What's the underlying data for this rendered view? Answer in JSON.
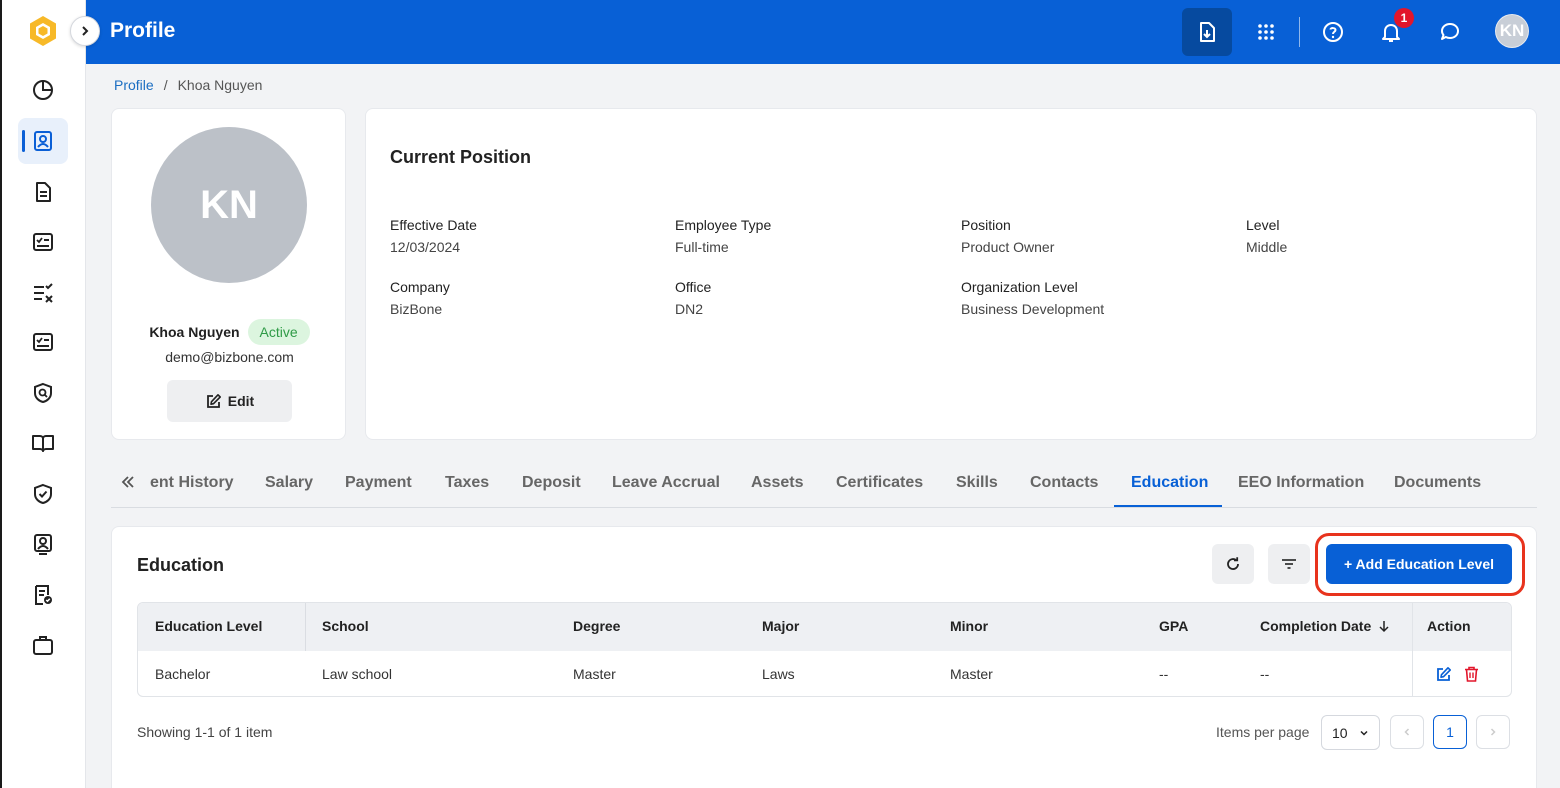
{
  "app": {
    "title": "Profile"
  },
  "topbar": {
    "notification_count": "1",
    "user_initials": "KN"
  },
  "breadcrumb": {
    "root": "Profile",
    "separator": "/",
    "current": "Khoa Nguyen"
  },
  "profile": {
    "initials": "KN",
    "name": "Khoa Nguyen",
    "status": "Active",
    "email": "demo@bizbone.com",
    "edit_label": "Edit"
  },
  "current_position": {
    "title": "Current Position",
    "fields": [
      {
        "label": "Effective Date",
        "value": "12/03/2024"
      },
      {
        "label": "Employee Type",
        "value": "Full-time"
      },
      {
        "label": "Position",
        "value": "Product Owner"
      },
      {
        "label": "Level",
        "value": "Middle"
      },
      {
        "label": "Company",
        "value": "BizBone"
      },
      {
        "label": "Office",
        "value": "DN2"
      },
      {
        "label": "Organization Level",
        "value": "Business Development"
      }
    ]
  },
  "tabs": [
    "ent History",
    "Salary",
    "Payment",
    "Taxes",
    "Deposit",
    "Leave Accrual",
    "Assets",
    "Certificates",
    "Skills",
    "Contacts",
    "Education",
    "EEO Information",
    "Documents"
  ],
  "active_tab": "Education",
  "education": {
    "title": "Education",
    "add_label": "+ Add Education Level",
    "columns": [
      "Education Level",
      "School",
      "Degree",
      "Major",
      "Minor",
      "GPA",
      "Completion Date",
      "Action"
    ],
    "rows": [
      [
        "Bachelor",
        "Law school",
        "Master",
        "Laws",
        "Master",
        "--",
        "--"
      ]
    ],
    "showing": "Showing 1-1 of 1 item",
    "items_per_page_label": "Items per page",
    "items_per_page": "10",
    "current_page": "1"
  },
  "colors": {
    "brand": "#0860d6",
    "active_status": "#2f9b47",
    "delete": "#e2162b",
    "highlight": "#e8331d"
  }
}
